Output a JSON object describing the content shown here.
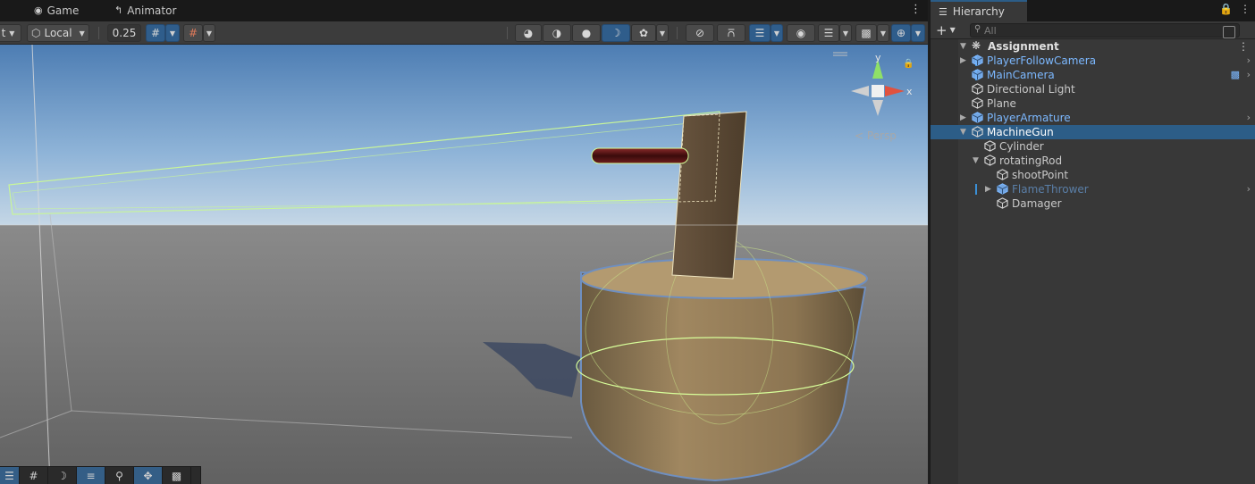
{
  "scene_tabs": [
    {
      "label": "Game",
      "icon": "gamepad-icon"
    },
    {
      "label": "Animator",
      "icon": "animator-icon"
    }
  ],
  "scene_toolbar": {
    "partial_label": "t",
    "pivot_rotation": "Local",
    "snap_value": "0.25"
  },
  "viewport": {
    "projection_label": "Persp",
    "axes": {
      "x": "x",
      "y": "y"
    }
  },
  "hierarchy": {
    "tab_label": "Hierarchy",
    "search_placeholder": "All",
    "scene_name": "Assignment",
    "items": [
      {
        "label": "PlayerFollowCamera",
        "depth": 0,
        "prefab": true,
        "expandable": true,
        "expanded": false,
        "selected": false
      },
      {
        "label": "MainCamera",
        "depth": 0,
        "prefab": true,
        "expandable": false,
        "expanded": false,
        "selected": false
      },
      {
        "label": "Directional Light",
        "depth": 0,
        "prefab": false,
        "expandable": false,
        "expanded": false,
        "selected": false
      },
      {
        "label": "Plane",
        "depth": 0,
        "prefab": false,
        "expandable": false,
        "expanded": false,
        "selected": false
      },
      {
        "label": "PlayerArmature",
        "depth": 0,
        "prefab": true,
        "expandable": true,
        "expanded": false,
        "selected": false
      },
      {
        "label": "MachineGun",
        "depth": 0,
        "prefab": false,
        "expandable": true,
        "expanded": true,
        "selected": true
      },
      {
        "label": "Cylinder",
        "depth": 1,
        "prefab": false,
        "expandable": false,
        "expanded": false,
        "selected": false
      },
      {
        "label": "rotatingRod",
        "depth": 1,
        "prefab": false,
        "expandable": true,
        "expanded": true,
        "selected": false
      },
      {
        "label": "shootPoint",
        "depth": 2,
        "prefab": false,
        "expandable": false,
        "expanded": false,
        "selected": false
      },
      {
        "label": "FlameThrower",
        "depth": 2,
        "prefab": true,
        "dim": true,
        "expandable": true,
        "expanded": false,
        "selected": false
      },
      {
        "label": "Damager",
        "depth": 2,
        "prefab": false,
        "expandable": false,
        "expanded": false,
        "selected": false
      }
    ]
  },
  "colors": {
    "selection": "#2c5d87",
    "prefab_text": "#7cb8ff",
    "sky_top": "#4f7fb5",
    "ground": "#6e6e6e",
    "object_tan": "#a08760",
    "selection_outline": "#b9ff8a"
  }
}
